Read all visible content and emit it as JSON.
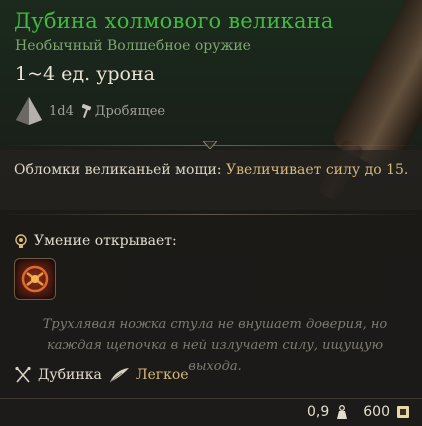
{
  "item": {
    "name": "Дубина холмового великана",
    "subtitle": "Необычный Волшебное оружие",
    "damage": "1~4 ед. урона",
    "damage_die": "1d4",
    "damage_type": "Дробящее"
  },
  "passive": {
    "name": "Обломки великаньей мощи:",
    "text_part1": "Увеличивает",
    "stat": "силу",
    "text_part2": "до",
    "value": "15."
  },
  "unlock": {
    "label": "Умение открывает:",
    "action_icon": "cudgel-action-icon"
  },
  "flavor": "Трухлявая ножка стула не внушает доверия, но каждая щепочка в ней излучает силу, ищущую выхода.",
  "tags": [
    {
      "label": "Дубинка",
      "icon": "crossed-clubs-icon"
    },
    {
      "label": "Легкое",
      "icon": "feather-icon"
    }
  ],
  "footer": {
    "weight": "0,9",
    "price": "600"
  },
  "colors": {
    "title": "#3fbb3f",
    "subtitle": "#7ea56f",
    "highlight": "#d6b97a"
  }
}
